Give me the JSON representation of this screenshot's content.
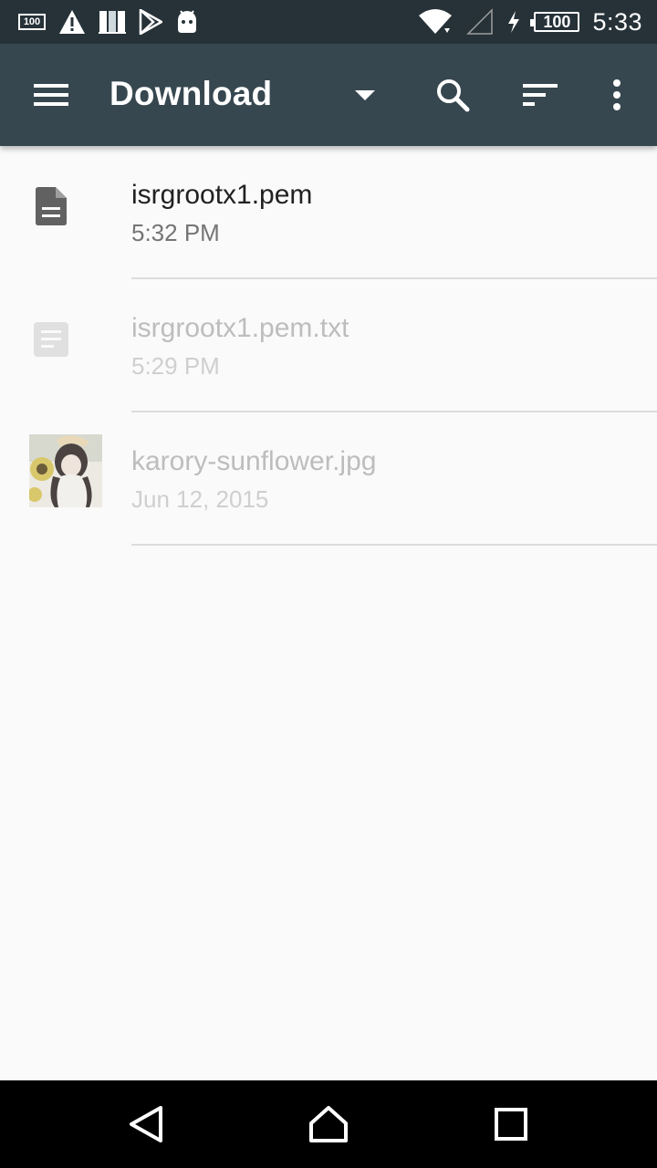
{
  "status_bar": {
    "left_icons": [
      "battery-100-mini-icon",
      "warning-icon",
      "signal-bars-icon",
      "play-store-icon",
      "android-icon"
    ],
    "mini_battery_label": "100",
    "battery_level": "100",
    "time": "5:33",
    "right_icons": [
      "wifi-icon",
      "cell-signal-icon",
      "charging-icon",
      "battery-icon"
    ]
  },
  "toolbar": {
    "title": "Download",
    "icons": [
      "menu-icon",
      "dropdown-arrow-icon",
      "search-icon",
      "sort-icon",
      "more-vert-icon"
    ],
    "color": "#37474f"
  },
  "files": [
    {
      "name": "isrgrootx1.pem",
      "date": "5:32 PM",
      "icon": "document-icon",
      "enabled": true
    },
    {
      "name": "isrgrootx1.pem.txt",
      "date": "5:29 PM",
      "icon": "text-file-icon",
      "enabled": false
    },
    {
      "name": "karory-sunflower.jpg",
      "date": "Jun 12, 2015",
      "icon": "image-thumbnail",
      "enabled": false
    }
  ],
  "nav_bar": {
    "icons": [
      "back-icon",
      "home-icon",
      "recents-icon"
    ]
  },
  "colors": {
    "status_bar": "#263238",
    "background": "#fafafa",
    "text_primary": "#212121",
    "text_disabled": "#bdbdbd"
  }
}
